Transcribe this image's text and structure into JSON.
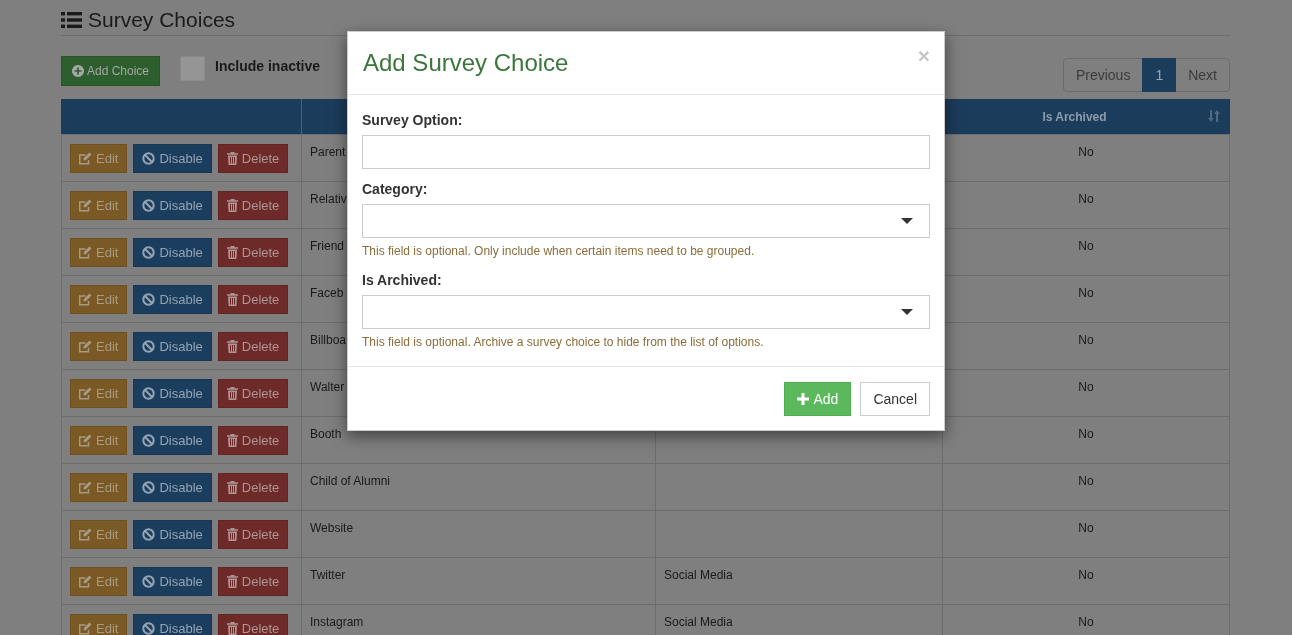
{
  "title": "Survey Choices",
  "add_button": "Add Choice",
  "include_inactive": {
    "label": "Include inactive",
    "checked": false
  },
  "pagination": {
    "previous": {
      "label": "Previous",
      "disabled": true
    },
    "pages": [
      {
        "label": "1",
        "selected": true
      }
    ],
    "next": {
      "label": "Next",
      "disabled": true
    }
  },
  "table": {
    "column_4_header": "Is Archived",
    "rows": [
      {
        "actions": [
          {
            "label": "Edit",
            "kind": "edit"
          },
          {
            "label": "Disable",
            "kind": "disable"
          },
          {
            "label": "Delete",
            "kind": "delete"
          }
        ],
        "column_2": "Parent",
        "column_4": "No"
      },
      {
        "actions": [
          {
            "label": "Edit",
            "kind": "edit"
          },
          {
            "label": "Disable",
            "kind": "disable"
          },
          {
            "label": "Delete",
            "kind": "delete"
          }
        ],
        "column_2": "Relativ",
        "column_4": "No"
      },
      {
        "actions": [
          {
            "label": "Edit",
            "kind": "edit"
          },
          {
            "label": "Disable",
            "kind": "disable"
          },
          {
            "label": "Delete",
            "kind": "delete"
          }
        ],
        "column_2": "Friend",
        "column_4": "No"
      },
      {
        "actions": [
          {
            "label": "Edit",
            "kind": "edit"
          },
          {
            "label": "Disable",
            "kind": "disable"
          },
          {
            "label": "Delete",
            "kind": "delete"
          }
        ],
        "column_2": "Faceb",
        "column_4": "No"
      },
      {
        "actions": [
          {
            "label": "Edit",
            "kind": "edit"
          },
          {
            "label": "Disable",
            "kind": "disable"
          },
          {
            "label": "Delete",
            "kind": "delete"
          }
        ],
        "column_2": "Billboa",
        "column_4": "No"
      },
      {
        "actions": [
          {
            "label": "Edit",
            "kind": "edit"
          },
          {
            "label": "Disable",
            "kind": "disable"
          },
          {
            "label": "Delete",
            "kind": "delete"
          }
        ],
        "column_2": "Walter",
        "column_4": "No"
      },
      {
        "actions": [
          {
            "label": "Edit",
            "kind": "edit"
          },
          {
            "label": "Disable",
            "kind": "disable"
          },
          {
            "label": "Delete",
            "kind": "delete"
          }
        ],
        "column_2": "Booth",
        "column_4": "No"
      },
      {
        "actions": [
          {
            "label": "Edit",
            "kind": "edit"
          },
          {
            "label": "Disable",
            "kind": "disable"
          },
          {
            "label": "Delete",
            "kind": "delete"
          }
        ],
        "column_2": "Child of Alumni",
        "column_4": "No"
      },
      {
        "actions": [
          {
            "label": "Edit",
            "kind": "edit"
          },
          {
            "label": "Disable",
            "kind": "disable"
          },
          {
            "label": "Delete",
            "kind": "delete"
          }
        ],
        "column_2": "Website",
        "column_4": "No"
      },
      {
        "actions": [
          {
            "label": "Edit",
            "kind": "edit"
          },
          {
            "label": "Disable",
            "kind": "disable"
          },
          {
            "label": "Delete",
            "kind": "delete"
          }
        ],
        "column_2": "Twitter",
        "column_3": "Social Media",
        "column_4": "No"
      },
      {
        "actions": [
          {
            "label": "Edit",
            "kind": "edit"
          },
          {
            "label": "Disable",
            "kind": "disable"
          },
          {
            "label": "Delete",
            "kind": "delete"
          }
        ],
        "column_2": "Instagram",
        "column_3": "Social Media",
        "column_4": "No"
      }
    ]
  },
  "modal": {
    "title": "Add Survey Choice",
    "close": "×",
    "fields": [
      {
        "label": "Survey Option:",
        "kind": "text"
      },
      {
        "label": "Category:",
        "kind": "select",
        "help": "This field is optional. Only include when certain items need to be grouped."
      },
      {
        "label": "Is Archived:",
        "kind": "select",
        "help": "This field is optional. Archive a survey choice to hide from the list of options."
      }
    ],
    "buttons": [
      {
        "label": "Add",
        "kind": "primary"
      },
      {
        "label": "Cancel",
        "kind": "default"
      }
    ]
  }
}
